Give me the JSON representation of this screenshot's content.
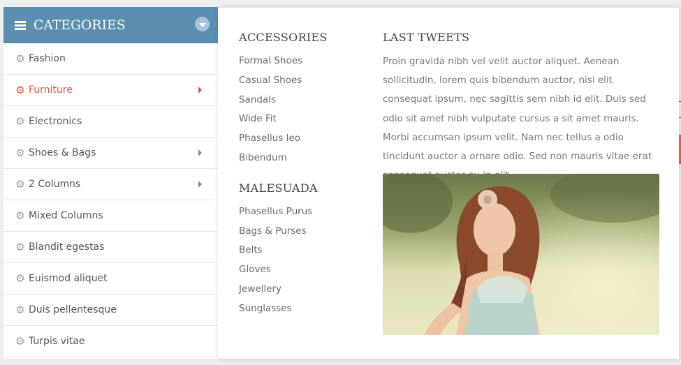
{
  "sidebar": {
    "title": "CATEGORIES",
    "items": [
      {
        "label": "Fashion",
        "has_submenu": false,
        "active": false
      },
      {
        "label": "Furniture",
        "has_submenu": true,
        "active": true
      },
      {
        "label": "Electronics",
        "has_submenu": false,
        "active": false
      },
      {
        "label": "Shoes & Bags",
        "has_submenu": true,
        "active": false
      },
      {
        "label": "2 Columns",
        "has_submenu": true,
        "active": false
      },
      {
        "label": "Mixed Columns",
        "has_submenu": false,
        "active": false
      },
      {
        "label": "Blandit egestas",
        "has_submenu": false,
        "active": false
      },
      {
        "label": "Euismod aliquet",
        "has_submenu": false,
        "active": false
      },
      {
        "label": "Duis pellentesque",
        "has_submenu": false,
        "active": false
      },
      {
        "label": "Turpis vitae",
        "has_submenu": false,
        "active": false
      }
    ]
  },
  "mega_menu": {
    "accessories": {
      "title": "ACCESSORIES",
      "links": [
        "Formal Shoes",
        "Casual Shoes",
        "Sandals",
        "Wide Fit",
        "Phasellus leo",
        "Bibendum"
      ]
    },
    "malesuada": {
      "title": "MALESUADA",
      "links": [
        "Phasellus Purus",
        "Bags & Purses",
        "Belts",
        "Gloves",
        "Jewellery",
        "Sunglasses"
      ]
    },
    "tweets": {
      "title": "LAST TWEETS",
      "text": "Proin gravida nibh vel velit auctor aliquet. Aenean sollicitudin, lorem quis bibendum auctor, nisi elit consequat ipsum, nec sagittis sem nibh id elit. Duis sed odio sit amet nibh vulputate cursus a sit amet mauris. Morbi accumsan ipsum velit. Nam nec tellus a odio tincidunt auctor a ornare odio. Sed non mauris vitae erat consequat auctor eu in elit."
    }
  },
  "colors": {
    "header_bg": "#5b8fb2",
    "accent": "#e8553d",
    "text": "#555555"
  },
  "icons": {
    "menu": "hamburger-icon",
    "dropdown": "chevron-down-icon",
    "item": "gear-icon",
    "submenu": "caret-right-icon"
  }
}
